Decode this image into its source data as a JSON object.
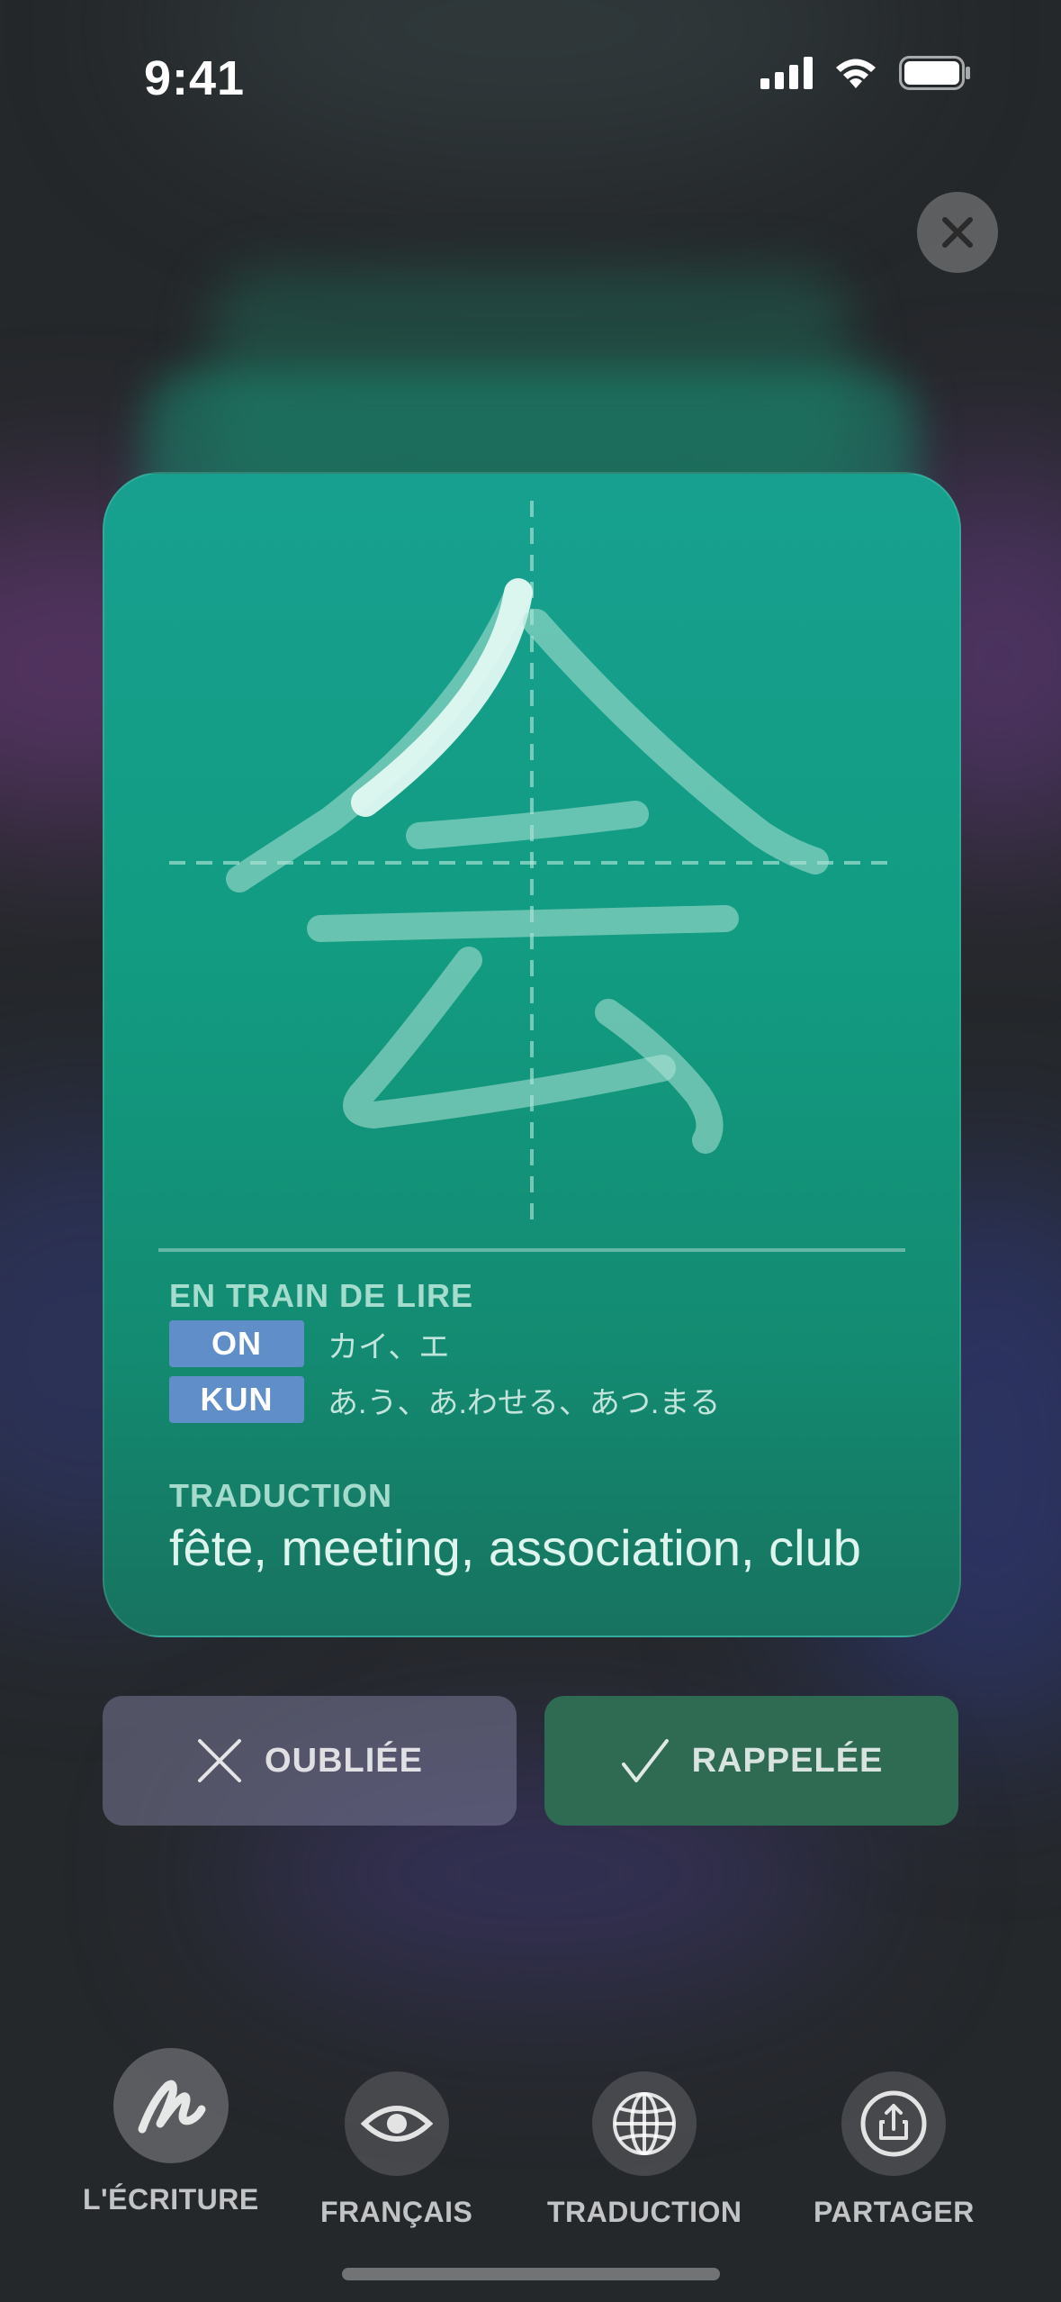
{
  "status_bar": {
    "time": "9:41"
  },
  "card": {
    "kanji": "会",
    "reading_label": "EN TRAIN DE LIRE",
    "on": {
      "label": "ON",
      "value": "カイ、エ"
    },
    "kun": {
      "label": "KUN",
      "value": "あ.う、あ.わせる、あつ.まる"
    },
    "translation_label": "TRADUCTION",
    "translation": "fête, meeting, association, club"
  },
  "actions": {
    "forgot_label": "OUBLIÉE",
    "remembered_label": "RAPPELÉE"
  },
  "tabs": [
    {
      "label": "L'ÉCRITURE",
      "icon": "handwriting-icon",
      "active": true
    },
    {
      "label": "FRANÇAIS",
      "icon": "eye-icon",
      "active": false
    },
    {
      "label": "TRADUCTION",
      "icon": "globe-icon",
      "active": false
    },
    {
      "label": "PARTAGER",
      "icon": "share-icon",
      "active": false
    }
  ],
  "colors": {
    "card": "#139c84",
    "badge": "#5f8ec9",
    "forgot_button": "#6f7090",
    "remembered_button": "#2f6a52"
  }
}
